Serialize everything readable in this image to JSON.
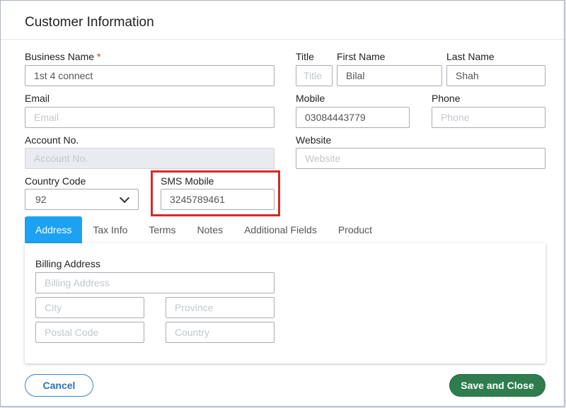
{
  "dialog": {
    "title": "Customer Information"
  },
  "form": {
    "business_name": {
      "label": "Business Name",
      "required_mark": "*",
      "value": "1st 4 connect"
    },
    "title": {
      "label": "Title",
      "placeholder": "Title"
    },
    "first_name": {
      "label": "First Name",
      "value": "Bilal"
    },
    "last_name": {
      "label": "Last Name",
      "value": "Shah"
    },
    "email": {
      "label": "Email",
      "placeholder": "Email"
    },
    "mobile": {
      "label": "Mobile",
      "value": "03084443779"
    },
    "phone": {
      "label": "Phone",
      "placeholder": "Phone"
    },
    "account_no": {
      "label": "Account No.",
      "placeholder": "Account No."
    },
    "website": {
      "label": "Website",
      "placeholder": "Website"
    },
    "country_code": {
      "label": "Country Code",
      "value": "92"
    },
    "sms_mobile": {
      "label": "SMS Mobile",
      "value": "3245789461"
    }
  },
  "tabs": [
    {
      "label": "Address",
      "active": true
    },
    {
      "label": "Tax Info"
    },
    {
      "label": "Terms"
    },
    {
      "label": "Notes"
    },
    {
      "label": "Additional Fields"
    },
    {
      "label": "Product"
    }
  ],
  "address": {
    "billing_label": "Billing Address",
    "billing_placeholder": "Billing Address",
    "city_placeholder": "City",
    "province_placeholder": "Province",
    "postal_placeholder": "Postal Code",
    "country_placeholder": "Country"
  },
  "actions": {
    "cancel_label": "Cancel",
    "save_label": "Save and Close"
  },
  "colors": {
    "accent_tab": "#1da1f2",
    "save_button": "#2f7d4f",
    "highlight": "#d42a2a",
    "required": "#d32f2f"
  }
}
